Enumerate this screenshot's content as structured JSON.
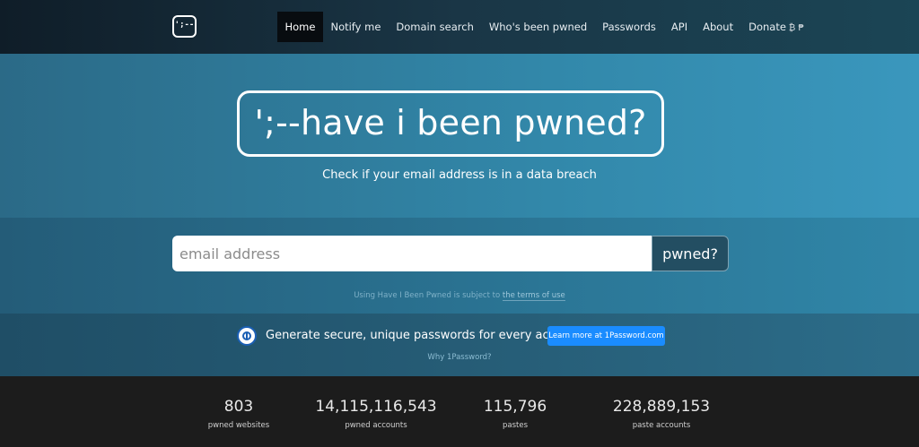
{
  "nav": {
    "logo_text": "';--",
    "items": [
      "Home",
      "Notify me",
      "Domain search",
      "Who's been pwned",
      "Passwords",
      "API",
      "About",
      "Donate"
    ],
    "donate_icons": "₿ ₱"
  },
  "hero": {
    "title": "';--have i been pwned?",
    "subtitle": "Check if your email address is in a data breach"
  },
  "search": {
    "placeholder": "email address",
    "button_label": "pwned?",
    "terms_prefix": "Using Have I Been Pwned is subject to ",
    "terms_link": "the terms of use"
  },
  "promo": {
    "text": "Generate secure, unique passwords for every account",
    "button_label": "Learn more at 1Password.com",
    "why_link": "Why 1Password?"
  },
  "stats": [
    {
      "value": "803",
      "label": "pwned websites"
    },
    {
      "value": "14,115,116,543",
      "label": "pwned accounts"
    },
    {
      "value": "115,796",
      "label": "pastes"
    },
    {
      "value": "228,889,153",
      "label": "paste accounts"
    }
  ]
}
